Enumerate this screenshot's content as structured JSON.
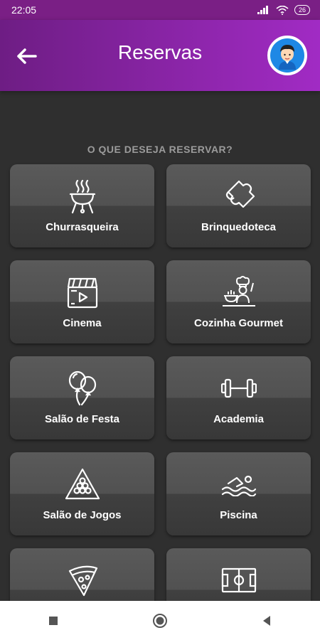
{
  "status_bar": {
    "time": "22:05",
    "battery": "26"
  },
  "header": {
    "title": "Reservas"
  },
  "section": {
    "heading": "O QUE DESEJA RESERVAR?"
  },
  "items": [
    {
      "label": "Churrasqueira",
      "icon": "grill-icon"
    },
    {
      "label": "Brinquedoteca",
      "icon": "puzzle-icon"
    },
    {
      "label": "Cinema",
      "icon": "clapperboard-icon"
    },
    {
      "label": "Cozinha Gourmet",
      "icon": "chef-icon"
    },
    {
      "label": "Salão de Festa",
      "icon": "balloons-icon"
    },
    {
      "label": "Academia",
      "icon": "dumbbell-icon"
    },
    {
      "label": "Salão de Jogos",
      "icon": "billiard-icon"
    },
    {
      "label": "Piscina",
      "icon": "swimmer-icon"
    },
    {
      "label": "",
      "icon": "pizza-icon"
    },
    {
      "label": "",
      "icon": "soccer-field-icon"
    }
  ],
  "colors": {
    "header_start": "#6e1d84",
    "header_end": "#a12bc4",
    "background": "#2f2f2f"
  }
}
